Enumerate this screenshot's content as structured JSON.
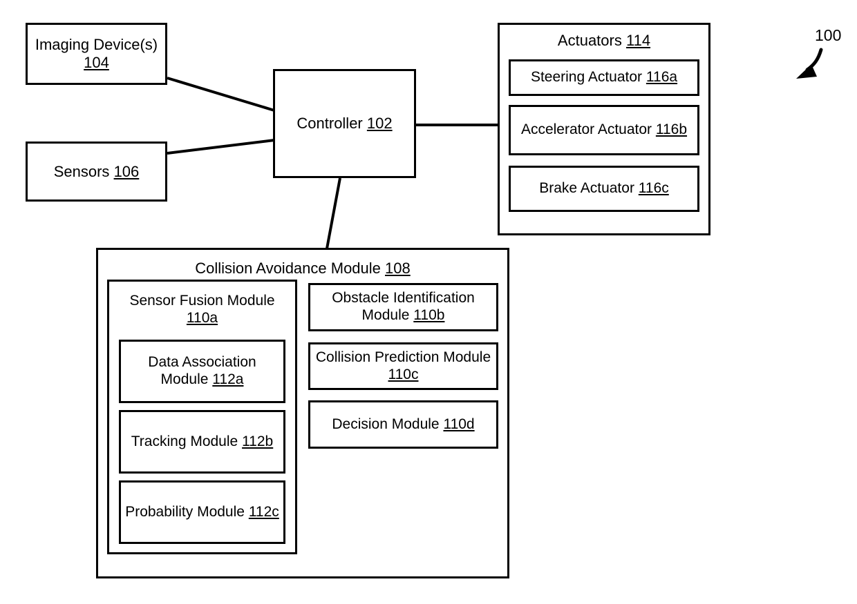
{
  "figure": {
    "number": "100",
    "pointer_icon": "curved-arrow-icon"
  },
  "blocks": {
    "imaging_device": {
      "label": "Imaging Device(s)",
      "ref": "104"
    },
    "sensors": {
      "label": "Sensors",
      "ref": "106"
    },
    "controller": {
      "label": "Controller",
      "ref": "102"
    },
    "actuators": {
      "label": "Actuators",
      "ref": "114"
    },
    "steering_actuator": {
      "label": "Steering Actuator",
      "ref": "116a"
    },
    "accelerator_actuator": {
      "label": "Accelerator Actuator",
      "ref": "116b"
    },
    "brake_actuator": {
      "label": "Brake Actuator",
      "ref": "116c"
    },
    "collision_avoidance_module": {
      "label": "Collision Avoidance Module",
      "ref": "108"
    },
    "sensor_fusion_module": {
      "label": "Sensor Fusion Module",
      "ref": "110a"
    },
    "data_association_module": {
      "label": "Data Association Module",
      "ref": "112a"
    },
    "tracking_module": {
      "label": "Tracking Module",
      "ref": "112b"
    },
    "probability_module": {
      "label": "Probability Module",
      "ref": "112c"
    },
    "obstacle_identification_module": {
      "label": "Obstacle Identification Module",
      "ref": "110b"
    },
    "collision_prediction_module": {
      "label": "Collision Prediction Module",
      "ref": "110c"
    },
    "decision_module": {
      "label": "Decision Module",
      "ref": "110d"
    }
  },
  "colors": {
    "stroke": "#000000",
    "fill": "#ffffff",
    "text": "#000000"
  }
}
